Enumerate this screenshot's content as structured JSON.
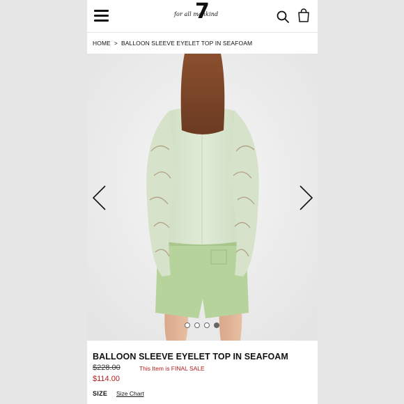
{
  "header": {
    "logo_text": "for all mankind",
    "logo_number": "7"
  },
  "breadcrumb": {
    "home": "HOME",
    "separator": ">",
    "current": "BALLOON SLEEVE EYELET TOP IN SEAFOAM"
  },
  "gallery": {
    "total_images": 4,
    "active_index": 4
  },
  "product": {
    "title": "BALLOON SLEEVE EYELET TOP IN SEAFOAM",
    "original_price": "$228.00",
    "sale_note": "This Item is FINAL SALE",
    "sale_price": "$114.00",
    "size_label": "SIZE",
    "size_chart_link": "Size Chart"
  },
  "colors": {
    "sale_red": "#b31b1b",
    "top_seafoam": "#d9e6cf",
    "shorts_green": "#b7d39c"
  },
  "icons": [
    "menu-icon",
    "brand-logo",
    "search-icon",
    "shopping-bag-icon",
    "chevron-left-icon",
    "chevron-right-icon"
  ]
}
